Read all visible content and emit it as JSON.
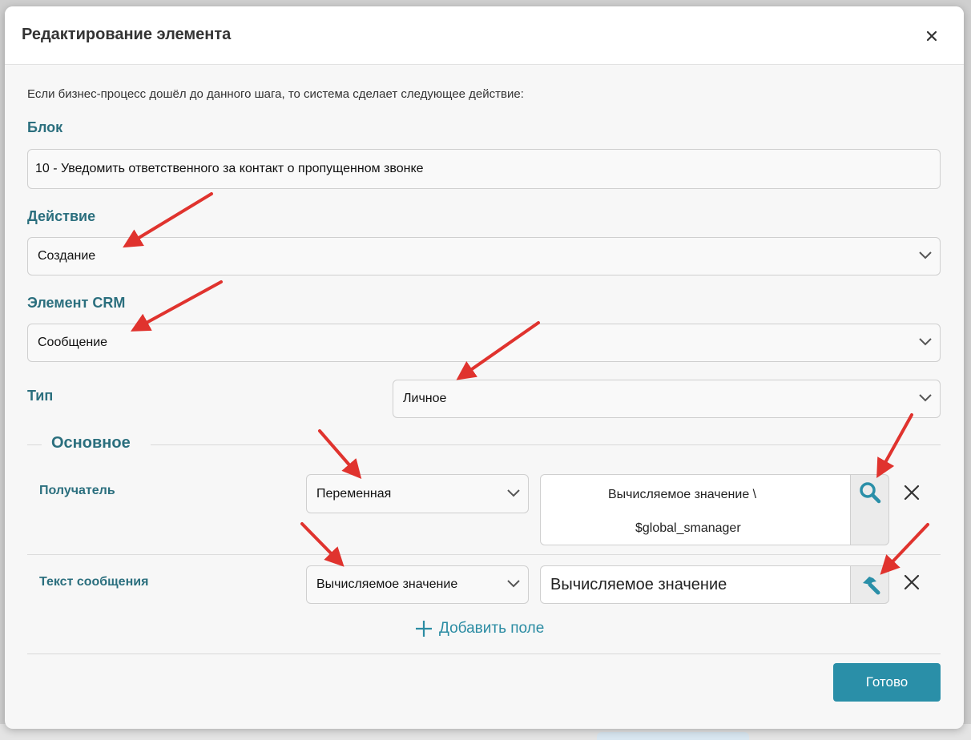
{
  "modal": {
    "title": "Редактирование элемента",
    "intro": "Если бизнес-процесс дошёл до данного шага, то система сделает следующее действие:"
  },
  "fields": {
    "block_label": "Блок",
    "block_value": "10 - Уведомить ответственного за контакт о пропущенном звонке",
    "action_label": "Действие",
    "action_value": "Создание",
    "crm_label": "Элемент CRM",
    "crm_value": "Сообщение",
    "type_label": "Тип",
    "type_value": "Личное"
  },
  "section": {
    "title": "Основное",
    "rows": [
      {
        "label": "Получатель",
        "source": "Переменная",
        "value_line1": "Вычисляемое значение \\",
        "value_line2": "$global_smanager",
        "icon": "search-icon"
      },
      {
        "label": "Текст сообщения",
        "source": "Вычисляемое значение",
        "value": "Вычисляемое значение",
        "icon": "hammer-icon"
      }
    ],
    "add_field": "Добавить поле"
  },
  "footer": {
    "done": "Готово"
  },
  "colors": {
    "accent": "#2b6f7e",
    "button": "#2a8fa8",
    "annotation_arrow": "#e0332e"
  }
}
